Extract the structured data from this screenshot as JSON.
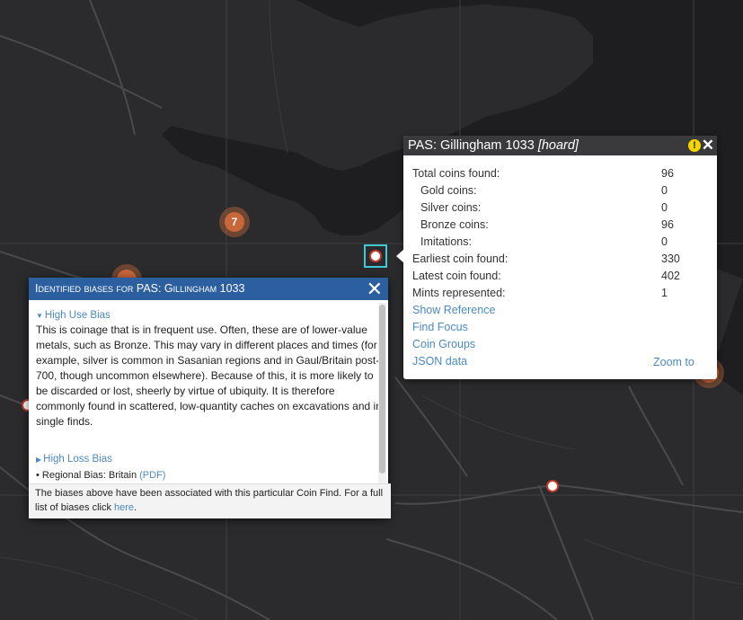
{
  "markers": {
    "cluster_count": "7"
  },
  "popup": {
    "title_main": "PAS: Gillingham 1033 ",
    "title_tag": "[hoard]",
    "warn_symbol": "!",
    "close_symbol": "✕",
    "rows": {
      "total_label": "Total coins found:",
      "total_value": "96",
      "gold_label": "Gold coins:",
      "gold_value": "0",
      "silver_label": "Silver coins:",
      "silver_value": "0",
      "bronze_label": "Bronze coins:",
      "bronze_value": "96",
      "imit_label": "Imitations:",
      "imit_value": "0",
      "earliest_label": "Earliest coin found:",
      "earliest_value": "330",
      "latest_label": "Latest coin found:",
      "latest_value": "402",
      "mints_label": "Mints represented:",
      "mints_value": "1"
    },
    "links": {
      "show_reference": "Show Reference",
      "find_focus": "Find Focus",
      "coin_groups": "Coin Groups",
      "json_data": "JSON data",
      "zoom_to": "Zoom to"
    }
  },
  "bias_dialog": {
    "title": "Identified biases for PAS: Gillingham 1033",
    "close_symbol": "✕",
    "high_use_title": "High Use Bias",
    "high_use_text": "This is coinage that is in frequent use. Often, these are of lower-value metals, such as Bronze. This may vary in different places and times (for example, silver is common in Sasanian regions and in Gaul/Britain post-700, though uncommon elsewhere). Because of this, it is more likely to be discarded or lost, sheerly by virtue of ubiquity. It is therefore commonly found in scattered, low-quantity caches on excavations and in single finds.",
    "high_loss_title": "High Loss Bias",
    "regional_text": "• Regional Bias: Britain ",
    "regional_link": "(PDF)",
    "footer_text": "The biases above have been associated with this particular Coin Find. For a full list of biases click ",
    "footer_link": "here",
    "footer_end": "."
  },
  "colors": {
    "map_background": "#2b2b2d",
    "popup_header": "#3a3a3c",
    "dialog_header": "#2c5fa0",
    "link": "#4a8ac5",
    "cluster": "#c9663a",
    "selection": "#3ec9d6"
  }
}
